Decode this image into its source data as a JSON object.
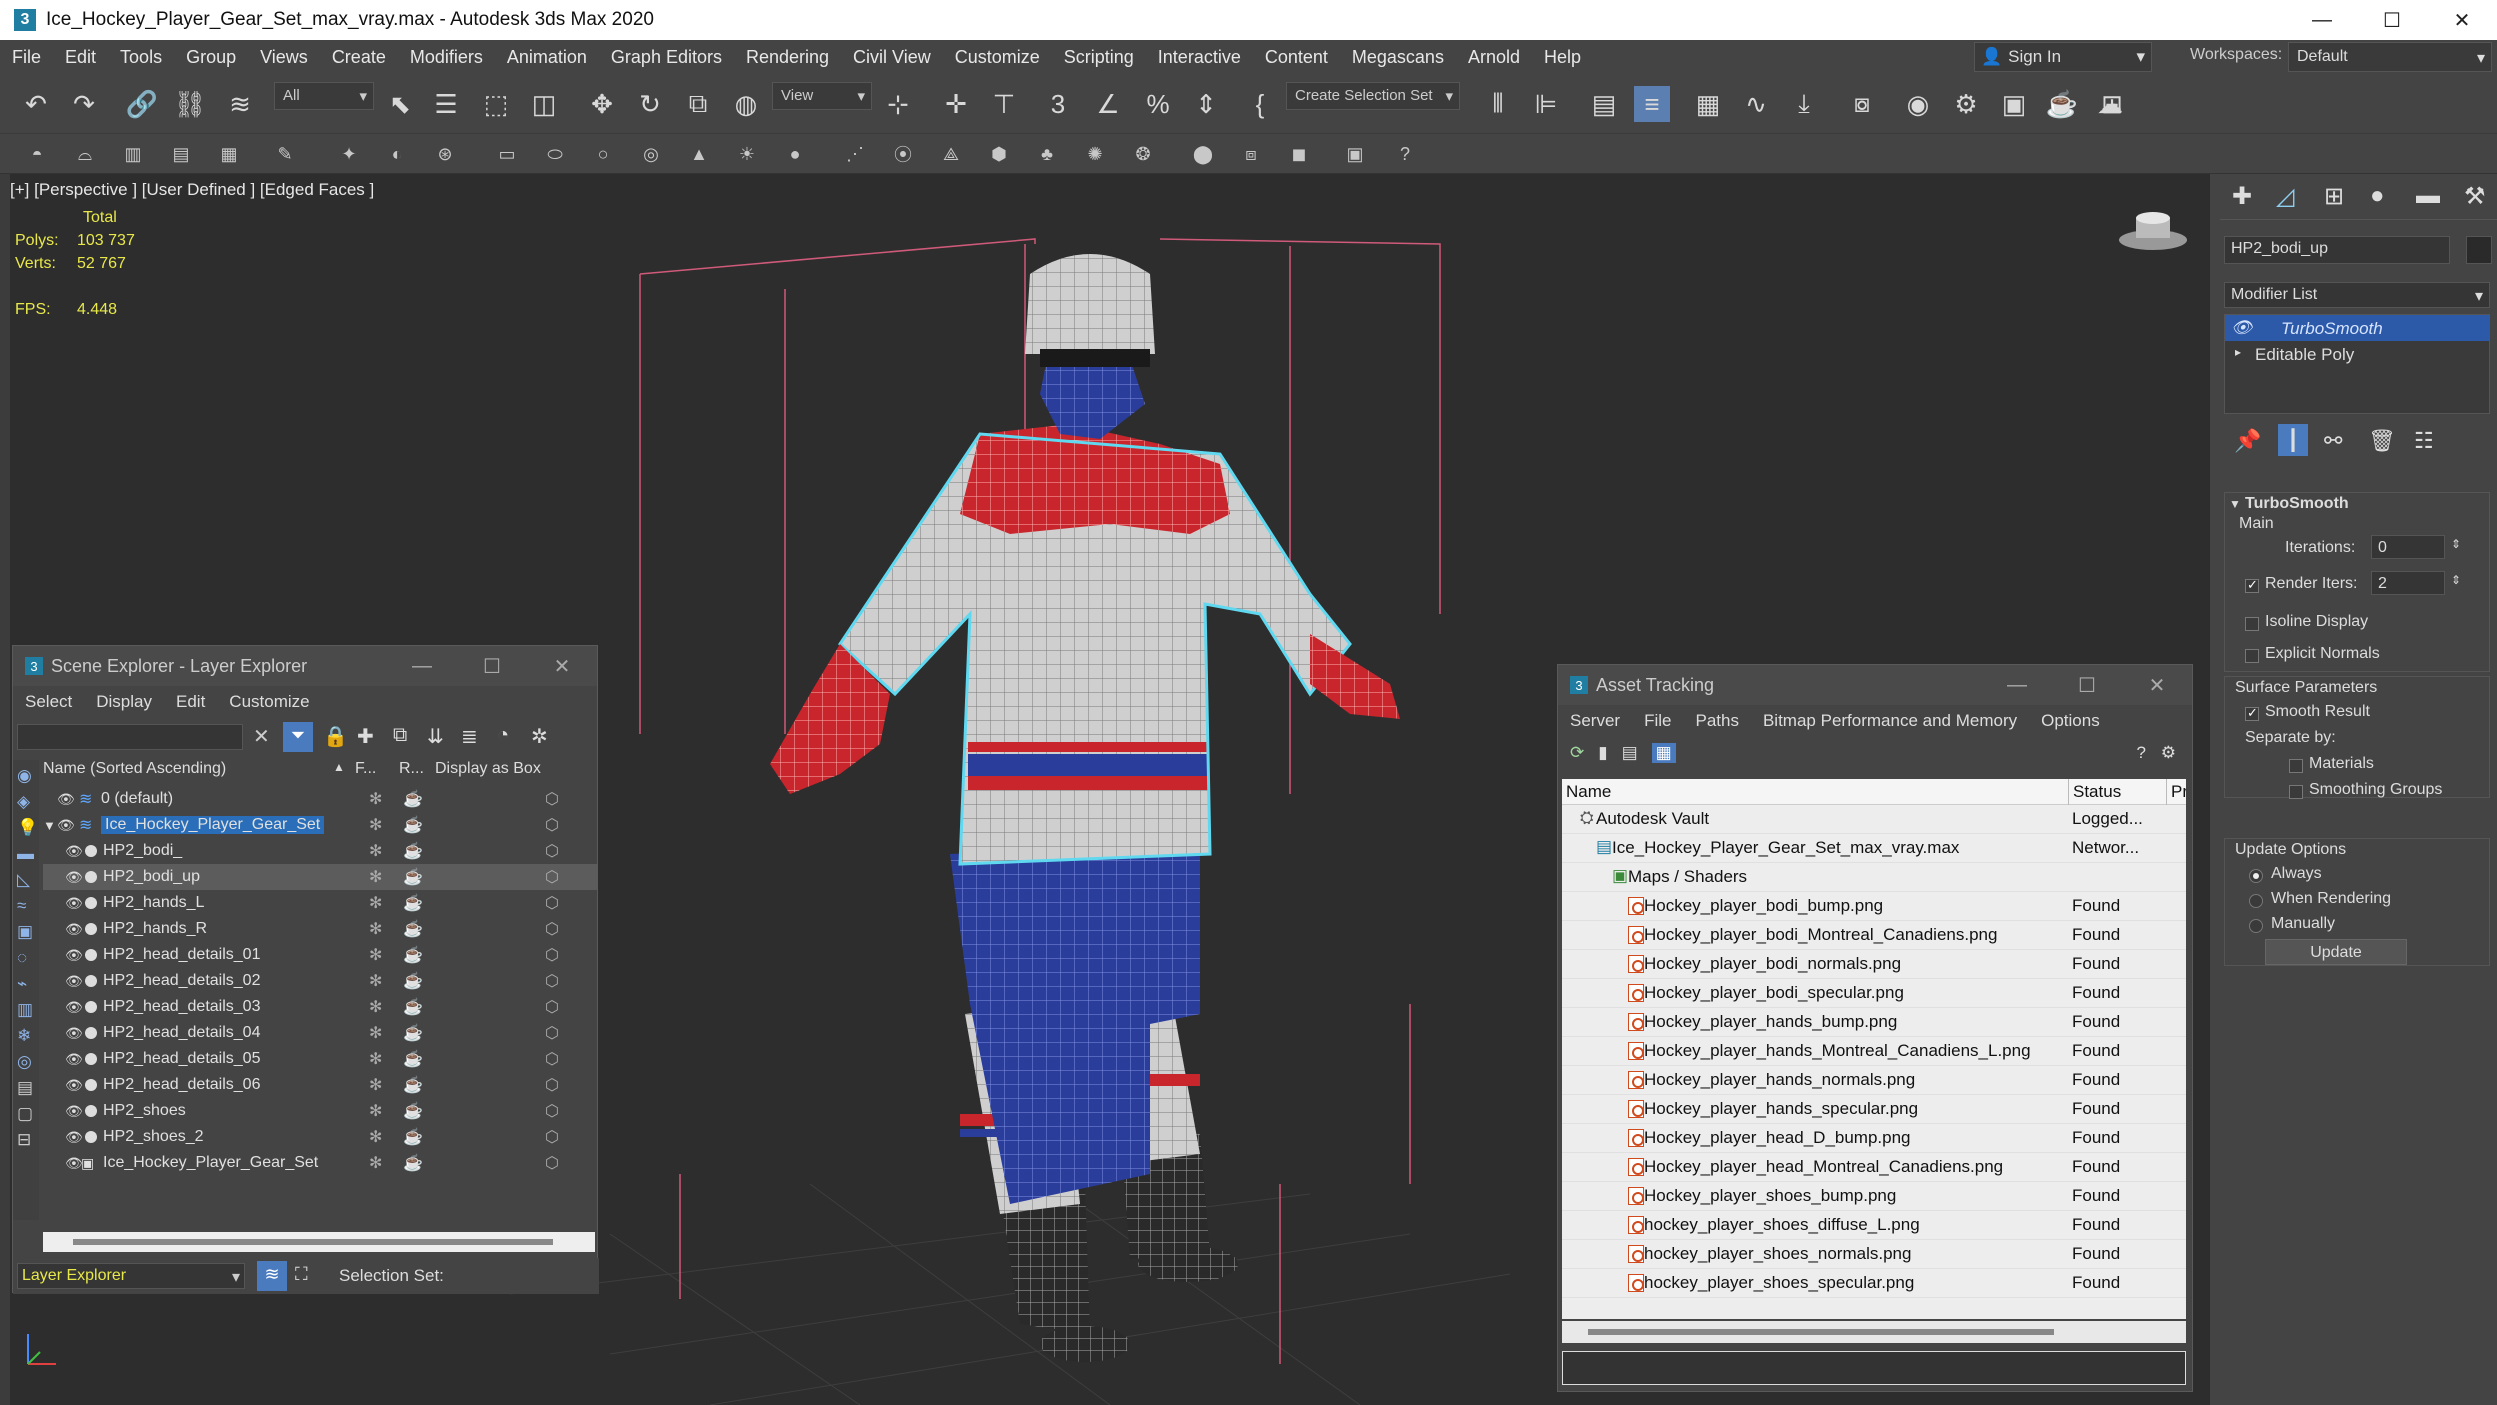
{
  "window": {
    "title": "Ice_Hockey_Player_Gear_Set_max_vray.max - Autodesk 3ds Max 2020",
    "minimize": "—",
    "maximize": "☐",
    "close": "✕"
  },
  "menu": [
    "File",
    "Edit",
    "Tools",
    "Group",
    "Views",
    "Create",
    "Modifiers",
    "Animation",
    "Graph Editors",
    "Rendering",
    "Civil View",
    "Customize",
    "Scripting",
    "Interactive",
    "Content",
    "Megascans",
    "Arnold",
    "Help"
  ],
  "signin": {
    "label": "Sign In"
  },
  "workspaces": {
    "label": "Workspaces:",
    "value": "Default"
  },
  "toolbar": {
    "filter_value": "All",
    "ref_coord": "View",
    "selection_set": "Create Selection Set"
  },
  "viewport": {
    "label": "[+] [Perspective ] [User Defined ] [Edged Faces ]",
    "stats": {
      "total_label": "Total",
      "polys_label": "Polys:",
      "polys": "103 737",
      "verts_label": "Verts:",
      "verts": "52 767",
      "fps_label": "FPS:",
      "fps": "4.448"
    }
  },
  "scene_explorer": {
    "title": "Scene Explorer - Layer Explorer",
    "menu": [
      "Select",
      "Display",
      "Edit",
      "Customize"
    ],
    "columns": {
      "name": "Name (Sorted Ascending)",
      "f": "F...",
      "r": "R...",
      "display_box": "Display as Box"
    },
    "rows": [
      {
        "name": "0 (default)",
        "indent": 1,
        "type": "layer"
      },
      {
        "name": "Ice_Hockey_Player_Gear_Set",
        "indent": 0,
        "type": "layer-active"
      },
      {
        "name": "HP2_bodi_",
        "indent": 2,
        "type": "obj"
      },
      {
        "name": "HP2_bodi_up",
        "indent": 2,
        "type": "obj",
        "selected": true
      },
      {
        "name": "HP2_hands_L",
        "indent": 2,
        "type": "obj"
      },
      {
        "name": "HP2_hands_R",
        "indent": 2,
        "type": "obj"
      },
      {
        "name": "HP2_head_details_01",
        "indent": 2,
        "type": "obj"
      },
      {
        "name": "HP2_head_details_02",
        "indent": 2,
        "type": "obj"
      },
      {
        "name": "HP2_head_details_03",
        "indent": 2,
        "type": "obj"
      },
      {
        "name": "HP2_head_details_04",
        "indent": 2,
        "type": "obj"
      },
      {
        "name": "HP2_head_details_05",
        "indent": 2,
        "type": "obj"
      },
      {
        "name": "HP2_head_details_06",
        "indent": 2,
        "type": "obj"
      },
      {
        "name": "HP2_shoes",
        "indent": 2,
        "type": "obj"
      },
      {
        "name": "HP2_shoes_2",
        "indent": 2,
        "type": "obj"
      },
      {
        "name": "Ice_Hockey_Player_Gear_Set",
        "indent": 2,
        "type": "group"
      }
    ],
    "footer": {
      "explorer": "Layer Explorer",
      "selection_set": "Selection Set:"
    }
  },
  "asset_tracking": {
    "title": "Asset Tracking",
    "menu": [
      "Server",
      "File",
      "Paths",
      "Bitmap Performance and Memory",
      "Options"
    ],
    "columns": {
      "name": "Name",
      "status": "Status",
      "pr": "Pr"
    },
    "rows": [
      {
        "name": "Autodesk Vault",
        "status": "Logged...",
        "indent": 0,
        "icon": "vault"
      },
      {
        "name": "Ice_Hockey_Player_Gear_Set_max_vray.max",
        "status": "Networ...",
        "indent": 1,
        "icon": "max"
      },
      {
        "name": "Maps / Shaders",
        "status": "",
        "indent": 2,
        "icon": "folder"
      },
      {
        "name": "Hockey_player_bodi_bump.png",
        "status": "Found",
        "indent": 3,
        "icon": "image"
      },
      {
        "name": "Hockey_player_bodi_Montreal_Canadiens.png",
        "status": "Found",
        "indent": 3,
        "icon": "image"
      },
      {
        "name": "Hockey_player_bodi_normals.png",
        "status": "Found",
        "indent": 3,
        "icon": "image"
      },
      {
        "name": "Hockey_player_bodi_specular.png",
        "status": "Found",
        "indent": 3,
        "icon": "image"
      },
      {
        "name": "Hockey_player_hands_bump.png",
        "status": "Found",
        "indent": 3,
        "icon": "image"
      },
      {
        "name": "Hockey_player_hands_Montreal_Canadiens_L.png",
        "status": "Found",
        "indent": 3,
        "icon": "image"
      },
      {
        "name": "Hockey_player_hands_normals.png",
        "status": "Found",
        "indent": 3,
        "icon": "image"
      },
      {
        "name": "Hockey_player_hands_specular.png",
        "status": "Found",
        "indent": 3,
        "icon": "image"
      },
      {
        "name": "Hockey_player_head_D_bump.png",
        "status": "Found",
        "indent": 3,
        "icon": "image"
      },
      {
        "name": "Hockey_player_head_Montreal_Canadiens.png",
        "status": "Found",
        "indent": 3,
        "icon": "image"
      },
      {
        "name": "Hockey_player_shoes_bump.png",
        "status": "Found",
        "indent": 3,
        "icon": "image"
      },
      {
        "name": "hockey_player_shoes_diffuse_L.png",
        "status": "Found",
        "indent": 3,
        "icon": "image"
      },
      {
        "name": "hockey_player_shoes_normals.png",
        "status": "Found",
        "indent": 3,
        "icon": "image"
      },
      {
        "name": "hockey_player_shoes_specular.png",
        "status": "Found",
        "indent": 3,
        "icon": "image"
      }
    ]
  },
  "command_panel": {
    "object_name": "HP2_bodi_up",
    "modifier_list": "Modifier List",
    "stack": [
      "TurboSmooth",
      "Editable Poly"
    ],
    "turbosmooth": {
      "title": "TurboSmooth",
      "main": "Main",
      "iterations_label": "Iterations:",
      "iterations": "0",
      "render_iters_label": "Render Iters:",
      "render_iters": "2",
      "isoline": "Isoline Display",
      "explicit_normals": "Explicit Normals",
      "surface_params": "Surface Parameters",
      "smooth_result": "Smooth Result",
      "separate_by": "Separate by:",
      "materials": "Materials",
      "smoothing_groups": "Smoothing Groups",
      "update_options": "Update Options",
      "always": "Always",
      "when_rendering": "When Rendering",
      "manually": "Manually",
      "update_button": "Update"
    }
  },
  "colors": {
    "selection": "#5fd8f0",
    "jersey_red": "#c8262c",
    "jersey_blue": "#2a3d9a",
    "active_layer": "#2a6db8",
    "stack_active": "#2c5aa8"
  }
}
